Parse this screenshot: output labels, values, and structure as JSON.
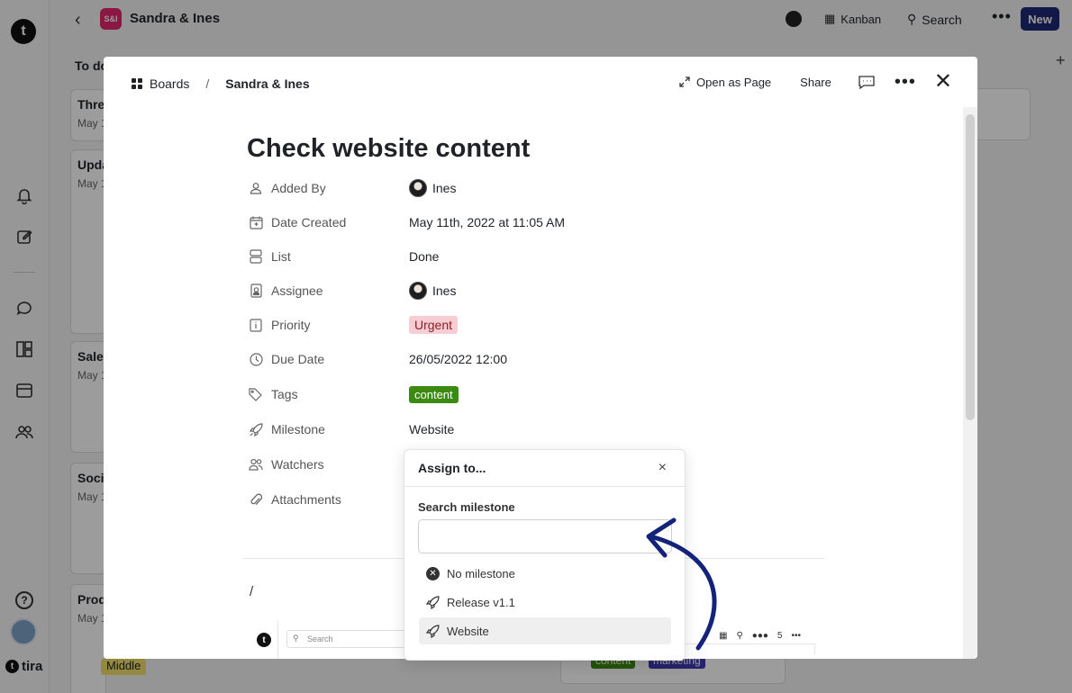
{
  "app": {
    "board_badge": "S&I",
    "board_name": "Sandra & Ines",
    "view_label": "Kanban",
    "search_label": "Search",
    "new_label": "New",
    "brand": "tira",
    "logo_letter": "t",
    "add_column": "+"
  },
  "background": {
    "column_title": "To do",
    "cards": [
      {
        "title": "Three",
        "date": "May 1"
      },
      {
        "title": "Upda",
        "date": "May 1"
      },
      {
        "title": "Sale",
        "date": "May 1"
      },
      {
        "title": "Soci",
        "date": "May 1"
      },
      {
        "title": "Prod",
        "date": "May 1"
      }
    ],
    "middle_tag": "Middle",
    "tags": [
      "content",
      "marketing"
    ]
  },
  "modal": {
    "breadcrumb": {
      "root": "Boards",
      "separator": "/",
      "current": "Sandra & Ines"
    },
    "actions": {
      "open_as_page": "Open as Page",
      "share": "Share"
    },
    "title": "Check website content",
    "properties": [
      {
        "label": "Added By",
        "value": "Ines",
        "icon": "user-icon"
      },
      {
        "label": "Date Created",
        "value": "May 11th, 2022 at 11:05 AM",
        "icon": "calendar-plus-icon"
      },
      {
        "label": "List",
        "value": "Done",
        "icon": "list-icon"
      },
      {
        "label": "Assignee",
        "value": "Ines",
        "icon": "id-badge-icon"
      },
      {
        "label": "Priority",
        "value": "Urgent",
        "icon": "info-icon"
      },
      {
        "label": "Due Date",
        "value": "26/05/2022 12:00",
        "icon": "clock-icon"
      },
      {
        "label": "Tags",
        "value": "content",
        "icon": "tag-icon"
      },
      {
        "label": "Milestone",
        "value": "Website",
        "icon": "rocket-icon"
      },
      {
        "label": "Watchers",
        "value": "",
        "icon": "users-icon"
      },
      {
        "label": "Attachments",
        "value": "",
        "icon": "paperclip-icon"
      }
    ],
    "body_text": "/",
    "embed": {
      "search_placeholder": "Search",
      "count": "5"
    }
  },
  "popover": {
    "title": "Assign to...",
    "close": "×",
    "search_label": "Search milestone",
    "search_value": "",
    "options": [
      {
        "label": "No milestone",
        "icon": "x-circle-icon",
        "selected": false
      },
      {
        "label": "Release v1.1",
        "icon": "rocket-icon",
        "selected": false
      },
      {
        "label": "Website",
        "icon": "rocket-icon",
        "selected": true
      }
    ]
  },
  "colors": {
    "accent": "#1e2a78",
    "urgent_bg": "#f7ccd2",
    "content_tag": "#3d8a10",
    "board_badge": "#e2286e",
    "annotation_arrow": "#14237a"
  }
}
